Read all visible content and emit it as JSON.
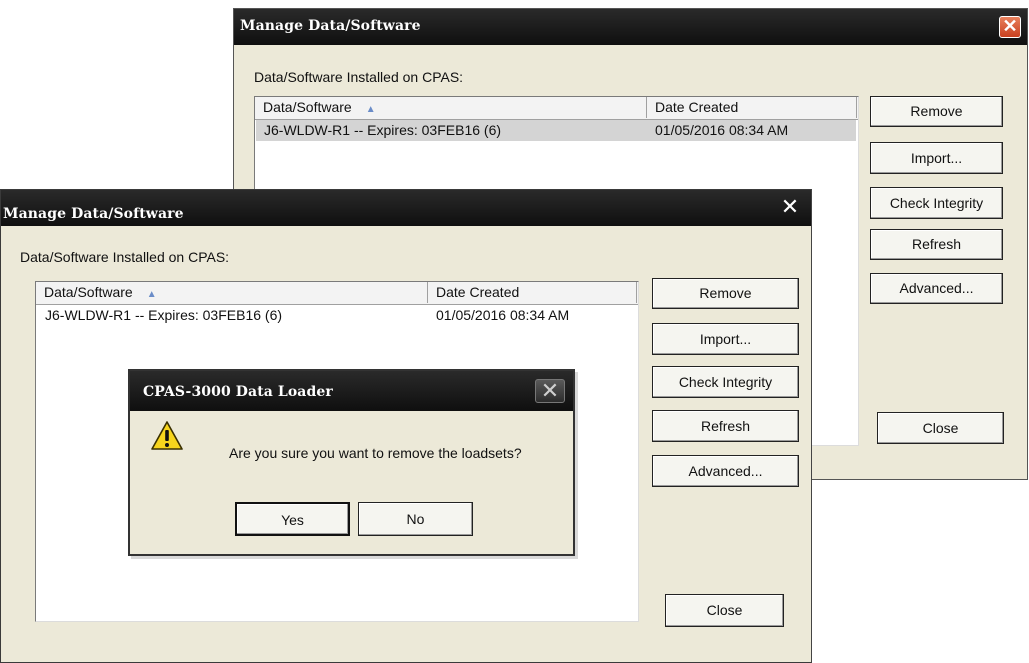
{
  "back_window": {
    "title": "Manage Data/Software",
    "section_label": "Data/Software Installed on CPAS:",
    "columns": [
      "Data/Software",
      "Date Created"
    ],
    "rows": [
      {
        "name": "J6-WLDW-R1 -- Expires: 03FEB16 (6)",
        "date": "01/05/2016 08:34 AM"
      }
    ],
    "buttons": {
      "remove": "Remove",
      "import": "Import...",
      "check": "Check Integrity",
      "refresh": "Refresh",
      "advanced": "Advanced...",
      "close": "Close"
    },
    "close_glyph": "✕"
  },
  "front_window": {
    "title": "Manage Data/Software",
    "section_label": "Data/Software Installed on CPAS:",
    "columns": [
      "Data/Software",
      "Date Created"
    ],
    "rows": [
      {
        "name": "J6-WLDW-R1 -- Expires: 03FEB16 (6)",
        "date": "01/05/2016 08:34 AM"
      }
    ],
    "buttons": {
      "remove": "Remove",
      "import": "Import...",
      "check": "Check Integrity",
      "refresh": "Refresh",
      "advanced": "Advanced...",
      "close": "Close"
    },
    "close_glyph": "✕"
  },
  "dialog": {
    "title": "CPAS-3000 Data Loader",
    "message": "Are you sure you want to remove the loadsets?",
    "yes": "Yes",
    "no": "No",
    "close_glyph": "✕",
    "icon": "warning-icon"
  },
  "sort_glyph": "▲",
  "colors": {
    "titlebar": "#111111",
    "window_bg": "#ece9d8",
    "close_red": "#d4532e",
    "selected_row": "#d4d4d4"
  }
}
